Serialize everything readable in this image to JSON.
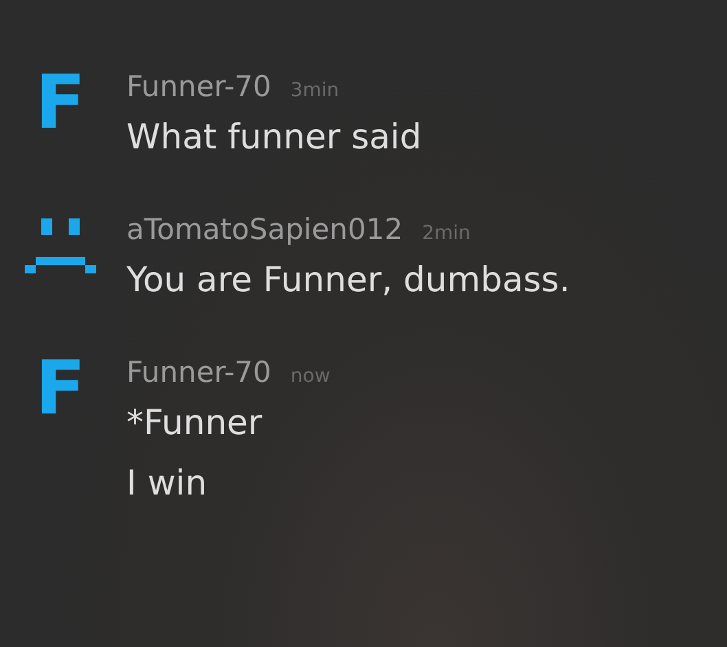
{
  "messages": [
    {
      "avatar": {
        "kind": "letter",
        "text": "F"
      },
      "author": "Funner-70",
      "time": "3min",
      "lines": [
        "What funner said"
      ]
    },
    {
      "avatar": {
        "kind": "face"
      },
      "author": "aTomatoSapien012",
      "time": "2min",
      "lines": [
        "You are Funner, dumbass."
      ]
    },
    {
      "avatar": {
        "kind": "letter",
        "text": "F"
      },
      "author": "Funner-70",
      "time": "now",
      "lines": [
        "*Funner",
        "I win"
      ]
    }
  ]
}
